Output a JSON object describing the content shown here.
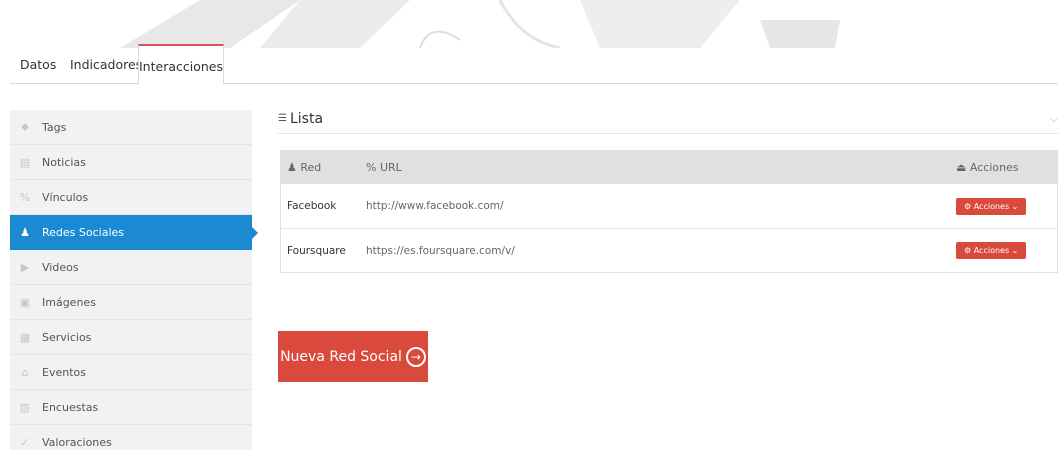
{
  "tabs": [
    "Datos",
    "Indicadores",
    "Interacciones"
  ],
  "sidebar": {
    "items": [
      {
        "label": "Tags",
        "icon": "tag-icon",
        "glyph": "⬥"
      },
      {
        "label": "Noticias",
        "icon": "newspaper-icon",
        "glyph": "▤"
      },
      {
        "label": "Vínculos",
        "icon": "link-icon",
        "glyph": "%"
      },
      {
        "label": "Redes Sociales",
        "icon": "user-icon",
        "glyph": "♟"
      },
      {
        "label": "Videos",
        "icon": "play-icon",
        "glyph": "▶"
      },
      {
        "label": "Imágenes",
        "icon": "image-icon",
        "glyph": "▣"
      },
      {
        "label": "Servicios",
        "icon": "chart-icon",
        "glyph": "▦"
      },
      {
        "label": "Eventos",
        "icon": "calendar-icon",
        "glyph": "⌂"
      },
      {
        "label": "Encuestas",
        "icon": "list-icon",
        "glyph": "▥"
      },
      {
        "label": "Valoraciones",
        "icon": "check-icon",
        "glyph": "✓"
      }
    ],
    "active_index": 3,
    "active_color": "#1b8ad3"
  },
  "list": {
    "title": "Lista",
    "title_icon": "list-icon",
    "collapse_glyph": "⌵"
  },
  "table": {
    "headers": {
      "red": "Red",
      "url": "URL",
      "acciones": "Acciones"
    },
    "rows": [
      {
        "red": "Facebook",
        "url": "http://www.facebook.com/",
        "action": "Acciones"
      },
      {
        "red": "Foursquare",
        "url": "https://es.foursquare.com/v/",
        "action": "Acciones"
      }
    ]
  },
  "new_button": {
    "label": "Nueva Red Social",
    "color": "#d9493c"
  }
}
